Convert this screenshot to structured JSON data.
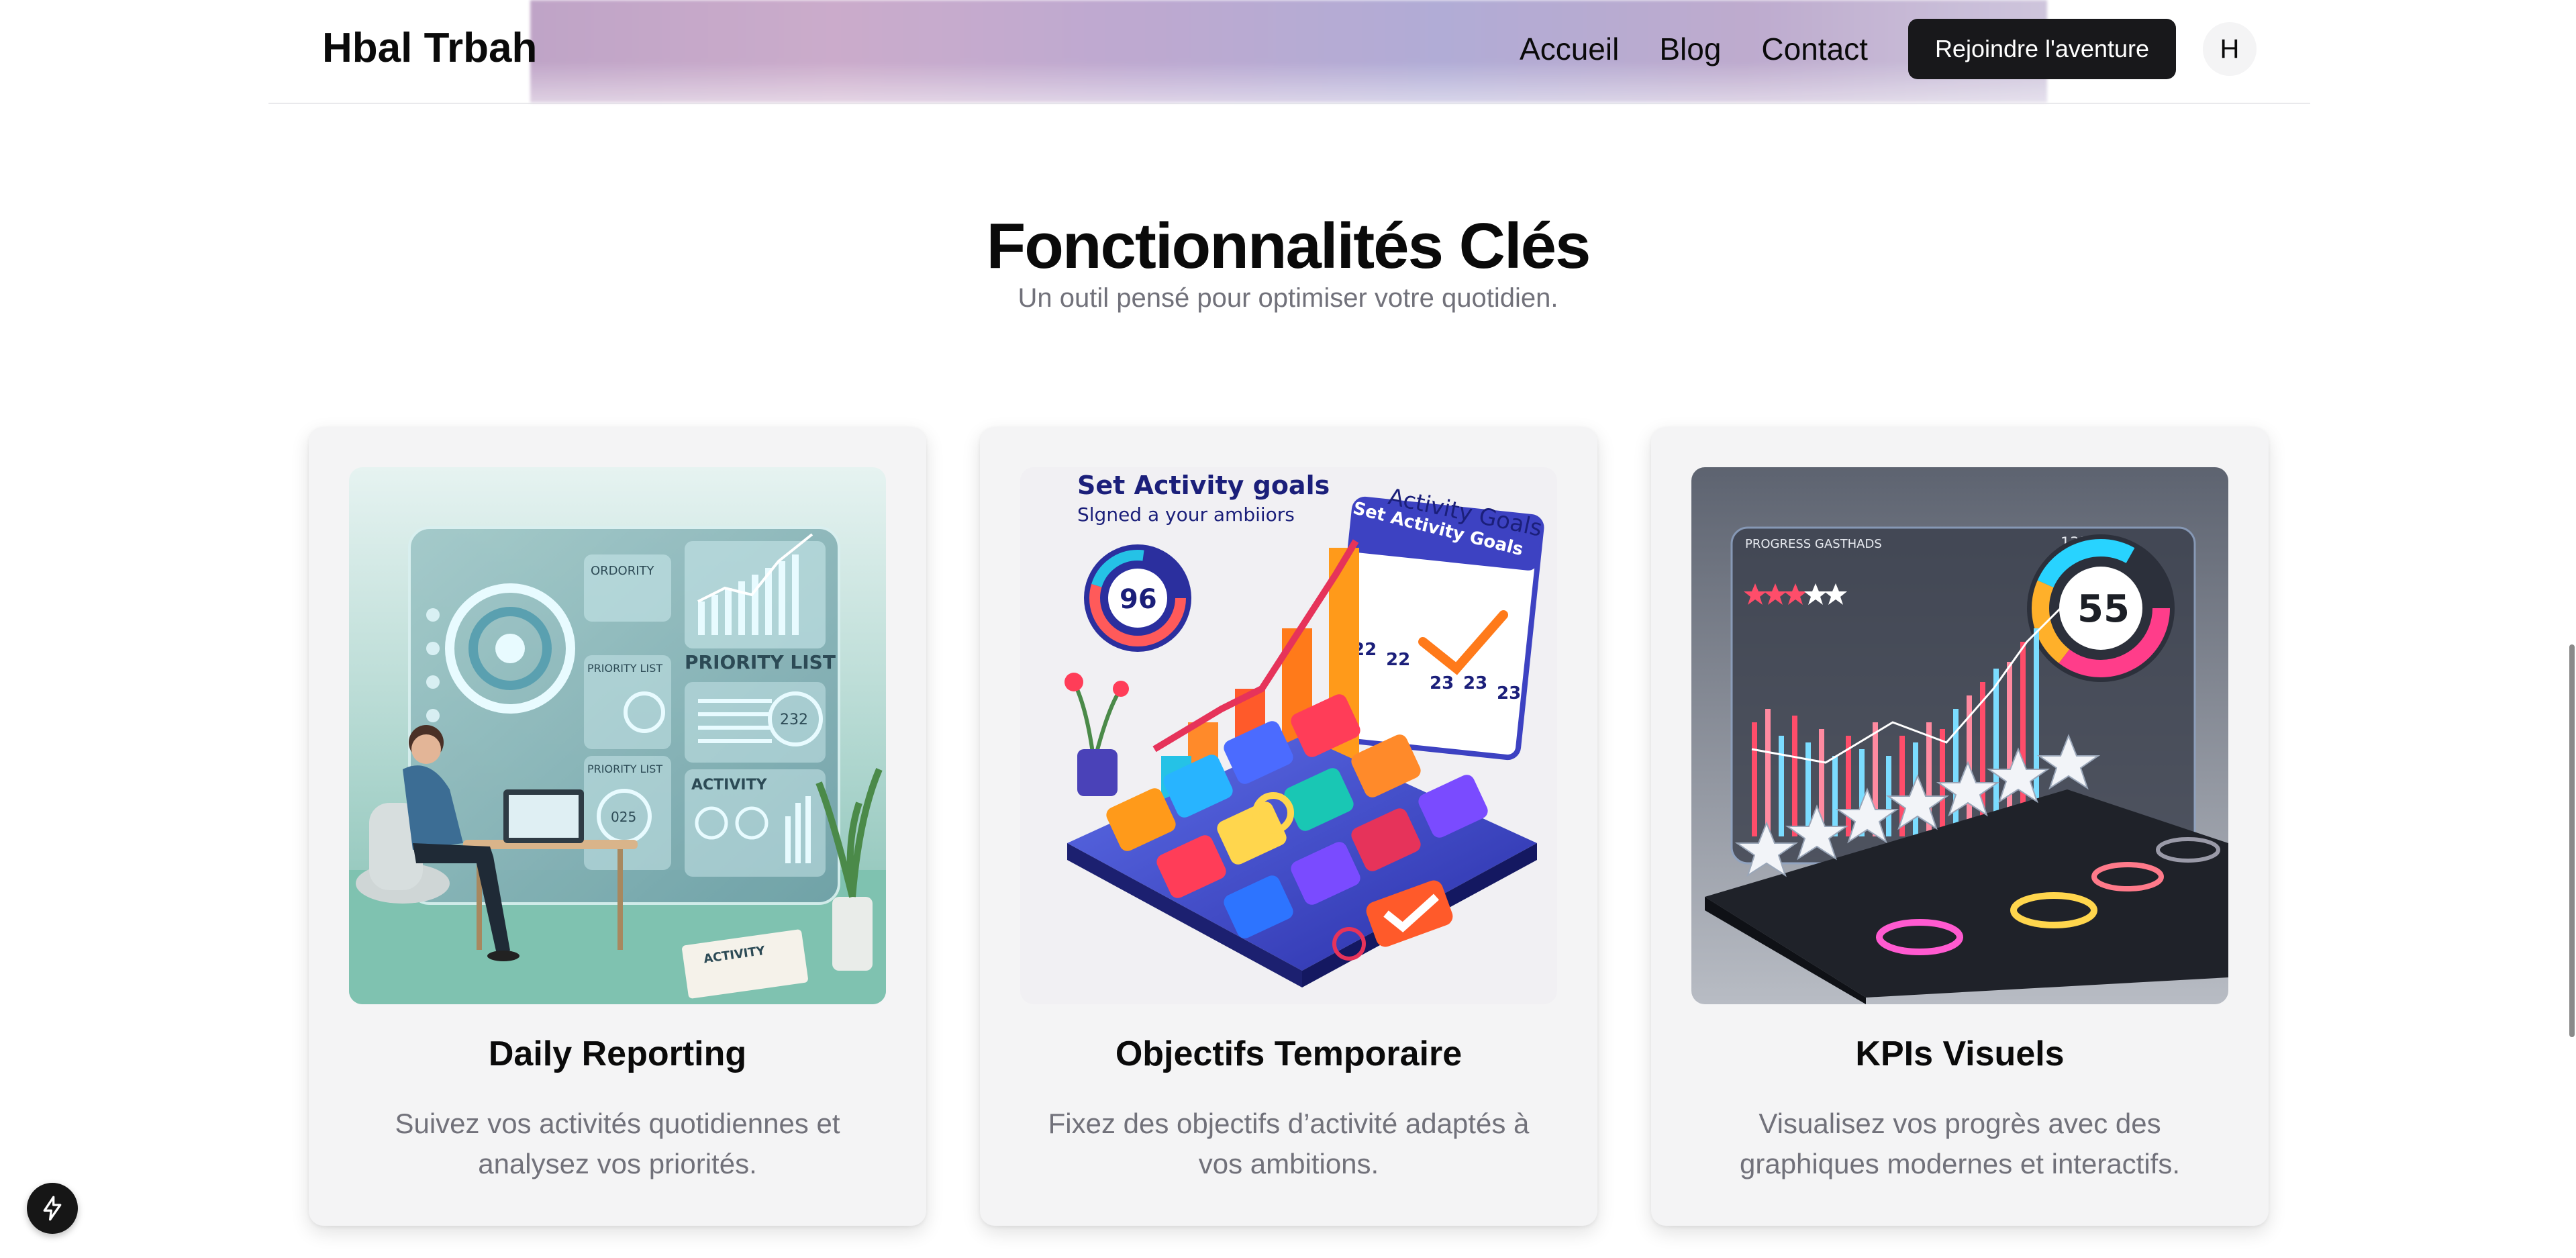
{
  "header": {
    "logo": "Hbal Trbah",
    "nav": [
      {
        "label": "Accueil"
      },
      {
        "label": "Blog"
      },
      {
        "label": "Contact"
      }
    ],
    "cta_label": "Rejoindre l'aventure",
    "avatar_initial": "H"
  },
  "section": {
    "title": "Fonctionnalités Clés",
    "subtitle": "Un outil pensé pour optimiser votre quotidien."
  },
  "cards": [
    {
      "title": "Daily Reporting",
      "description": "Suivez vos activités quotidiennes et analysez vos priorités.",
      "image_text": {
        "priority_list": "PRIORITY LIST",
        "priority_list_small": "PRIORITY LIST",
        "priority_list_2": "PRIORITY LIST",
        "activity": "ACTIVITY",
        "ordority": "ORDORITY",
        "num_232": "232",
        "num_025": "025",
        "activity_clip": "ACTIVITY"
      }
    },
    {
      "title": "Objectifs Temporaire",
      "description": "Fixez des objectifs d’activité adaptés à vos ambitions.",
      "image_text": {
        "headline": "Set Activity goals",
        "subline": "Slgned a your ambiiors",
        "calendar_title": "Activity Goals",
        "calendar_sub": "Set Activity Goals",
        "gauge_value": "96",
        "cal_cells": [
          "22",
          "22",
          "23",
          "23",
          "23"
        ]
      }
    },
    {
      "title": "KPIs Visuels",
      "description": "Visualisez vos progrès avec des graphiques modernes et interactifs.",
      "image_text": {
        "header": "PROGRESS GASTHADS",
        "percent": "13%",
        "gauge_value": "55"
      }
    }
  ],
  "colors": {
    "accent_dark": "#18181b",
    "muted_text": "#71717a",
    "card_bg": "#f4f4f5"
  },
  "icons": {
    "fab": "bolt-icon"
  }
}
